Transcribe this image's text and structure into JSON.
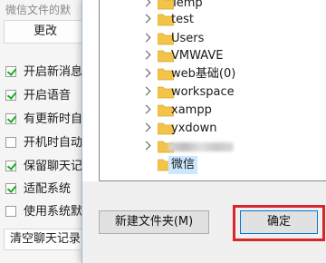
{
  "bg_panel": {
    "section_label": "微信文件的默",
    "change_label": "更改",
    "options": [
      {
        "label": "开启新消息",
        "checked": true
      },
      {
        "label": "开启语音",
        "checked": true
      },
      {
        "label": "有更新时自",
        "checked": true
      },
      {
        "label": "开机时自动",
        "checked": false
      },
      {
        "label": "保留聊天记",
        "checked": true
      },
      {
        "label": "适配系统",
        "checked": true
      },
      {
        "label": "使用系统默",
        "checked": false
      }
    ],
    "clear_label": "清空聊天记录"
  },
  "tree": {
    "items": [
      {
        "label": "Temp"
      },
      {
        "label": "test"
      },
      {
        "label": "Users"
      },
      {
        "label": "VMWAVE"
      },
      {
        "label": "web基础(0)"
      },
      {
        "label": "workspace"
      },
      {
        "label": "xampp"
      },
      {
        "label": "yxdown"
      },
      {
        "label": "",
        "blurred": true
      },
      {
        "label": "微信",
        "selected": true
      }
    ]
  },
  "buttons": {
    "new_folder": "新建文件夹(M)",
    "ok": "确定"
  },
  "colors": {
    "folder": "#f3c34a",
    "selection": "#cce8ff",
    "check": "#1aad19",
    "highlight": "#d9262b"
  }
}
